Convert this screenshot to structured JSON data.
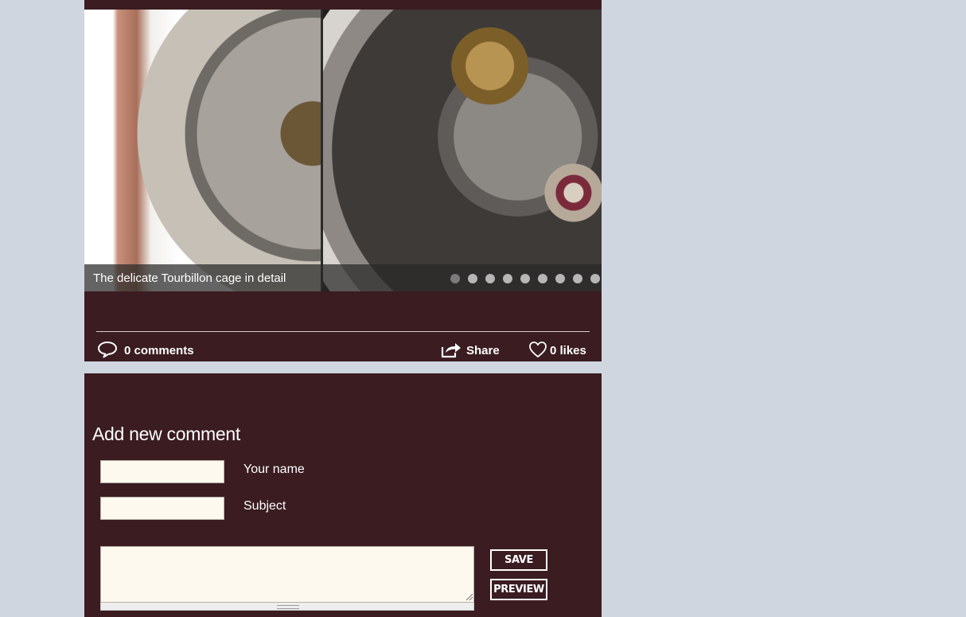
{
  "article": {
    "slideshow": {
      "caption": "The delicate Tourbillon cage in detail",
      "slide_count": 9,
      "active_index": 0
    },
    "meta": {
      "comments_label": "0 comments",
      "share_label": "Share",
      "likes_label": "0 likes"
    }
  },
  "comment_form": {
    "title": "Add new comment",
    "name_label": "Your name",
    "name_value": "",
    "subject_label": "Subject",
    "subject_value": "",
    "body_value": "",
    "save_label": "SAVE",
    "preview_label": "PREVIEW"
  },
  "icons": {
    "comments": "speech-bubble-icon",
    "share": "share-arrow-icon",
    "likes": "heart-icon"
  },
  "colors": {
    "page_background": "#cfd6df",
    "card_background": "#3a1c21",
    "field_background": "#fdf9ee",
    "text": "#ffffff"
  }
}
